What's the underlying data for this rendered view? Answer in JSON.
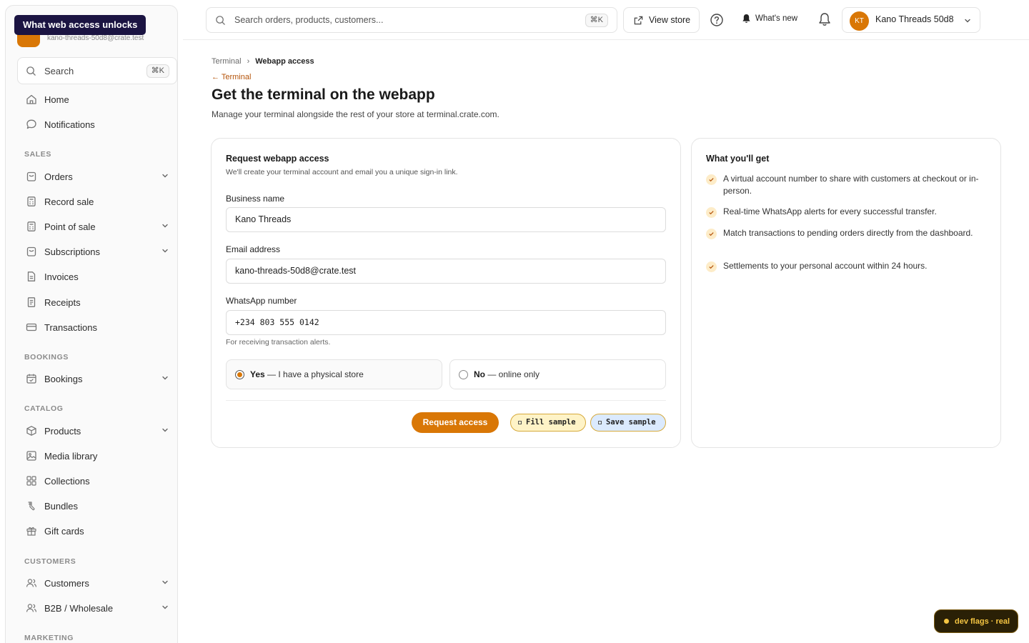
{
  "tooltip": "What web access unlocks",
  "brand": {
    "subtitle": "kano-threads-50d8@crate.test"
  },
  "sidebar": {
    "search_label": "Search",
    "search_shortcut": "⌘K",
    "home": "Home",
    "notifications": "Notifications",
    "sections": {
      "sales": "SALES",
      "bookings": "BOOKINGS",
      "catalog": "CATALOG",
      "customers": "CUSTOMERS",
      "marketing": "MARKETING"
    },
    "items": {
      "orders": "Orders",
      "record_sale": "Record sale",
      "point_of_sale": "Point of sale",
      "subscriptions": "Subscriptions",
      "invoices": "Invoices",
      "receipts": "Receipts",
      "transactions": "Transactions",
      "bookings": "Bookings",
      "products": "Products",
      "media_library": "Media library",
      "collections": "Collections",
      "bundles": "Bundles",
      "gift_cards": "Gift cards",
      "customers": "Customers",
      "b2b": "B2B / Wholesale"
    }
  },
  "topbar": {
    "search_placeholder": "Search orders, products, customers...",
    "search_shortcut": "⌘K",
    "view_store": "View store",
    "whats_new": "What's new",
    "account_initials": "KT",
    "account_name": "Kano Threads 50d8"
  },
  "page": {
    "breadcrumb_parent": "Terminal",
    "breadcrumb_separator": "›",
    "breadcrumb_current": "Webapp access",
    "back_link": "← Terminal",
    "title": "Get the terminal on the webapp",
    "subtitle": "Manage your terminal alongside the rest of your store at terminal.crate.com."
  },
  "form": {
    "title": "Request webapp access",
    "subtitle": "We'll create your terminal account and email you a unique sign-in link.",
    "business_name_label": "Business name",
    "business_name_value": "Kano Threads",
    "email_label": "Email address",
    "email_value": "kano-threads-50d8@crate.test",
    "whatsapp_label": "WhatsApp number",
    "whatsapp_value": "+234 803 555 0142",
    "whatsapp_help": "For receiving transaction alerts.",
    "radio_yes_strong": "Yes",
    "radio_yes_rest": " — I have a physical store",
    "radio_no_strong": "No",
    "radio_no_rest": " — online only",
    "radio_selected": "yes",
    "submit": "Request access",
    "fill_sample": "Fill sample",
    "save_sample": "Save sample"
  },
  "info": {
    "title": "What you'll get",
    "benefits": [
      "A virtual account number to share with customers at checkout or in-person.",
      "Real-time WhatsApp alerts for every successful transfer.",
      "Match transactions to pending orders directly from the dashboard.",
      "Settlements to your personal account within 24 hours."
    ]
  },
  "devflags": "dev flags · real",
  "colors": {
    "accent": "#d97706",
    "tooltip_bg": "#1b1442",
    "check_bg": "#fdecc8"
  }
}
